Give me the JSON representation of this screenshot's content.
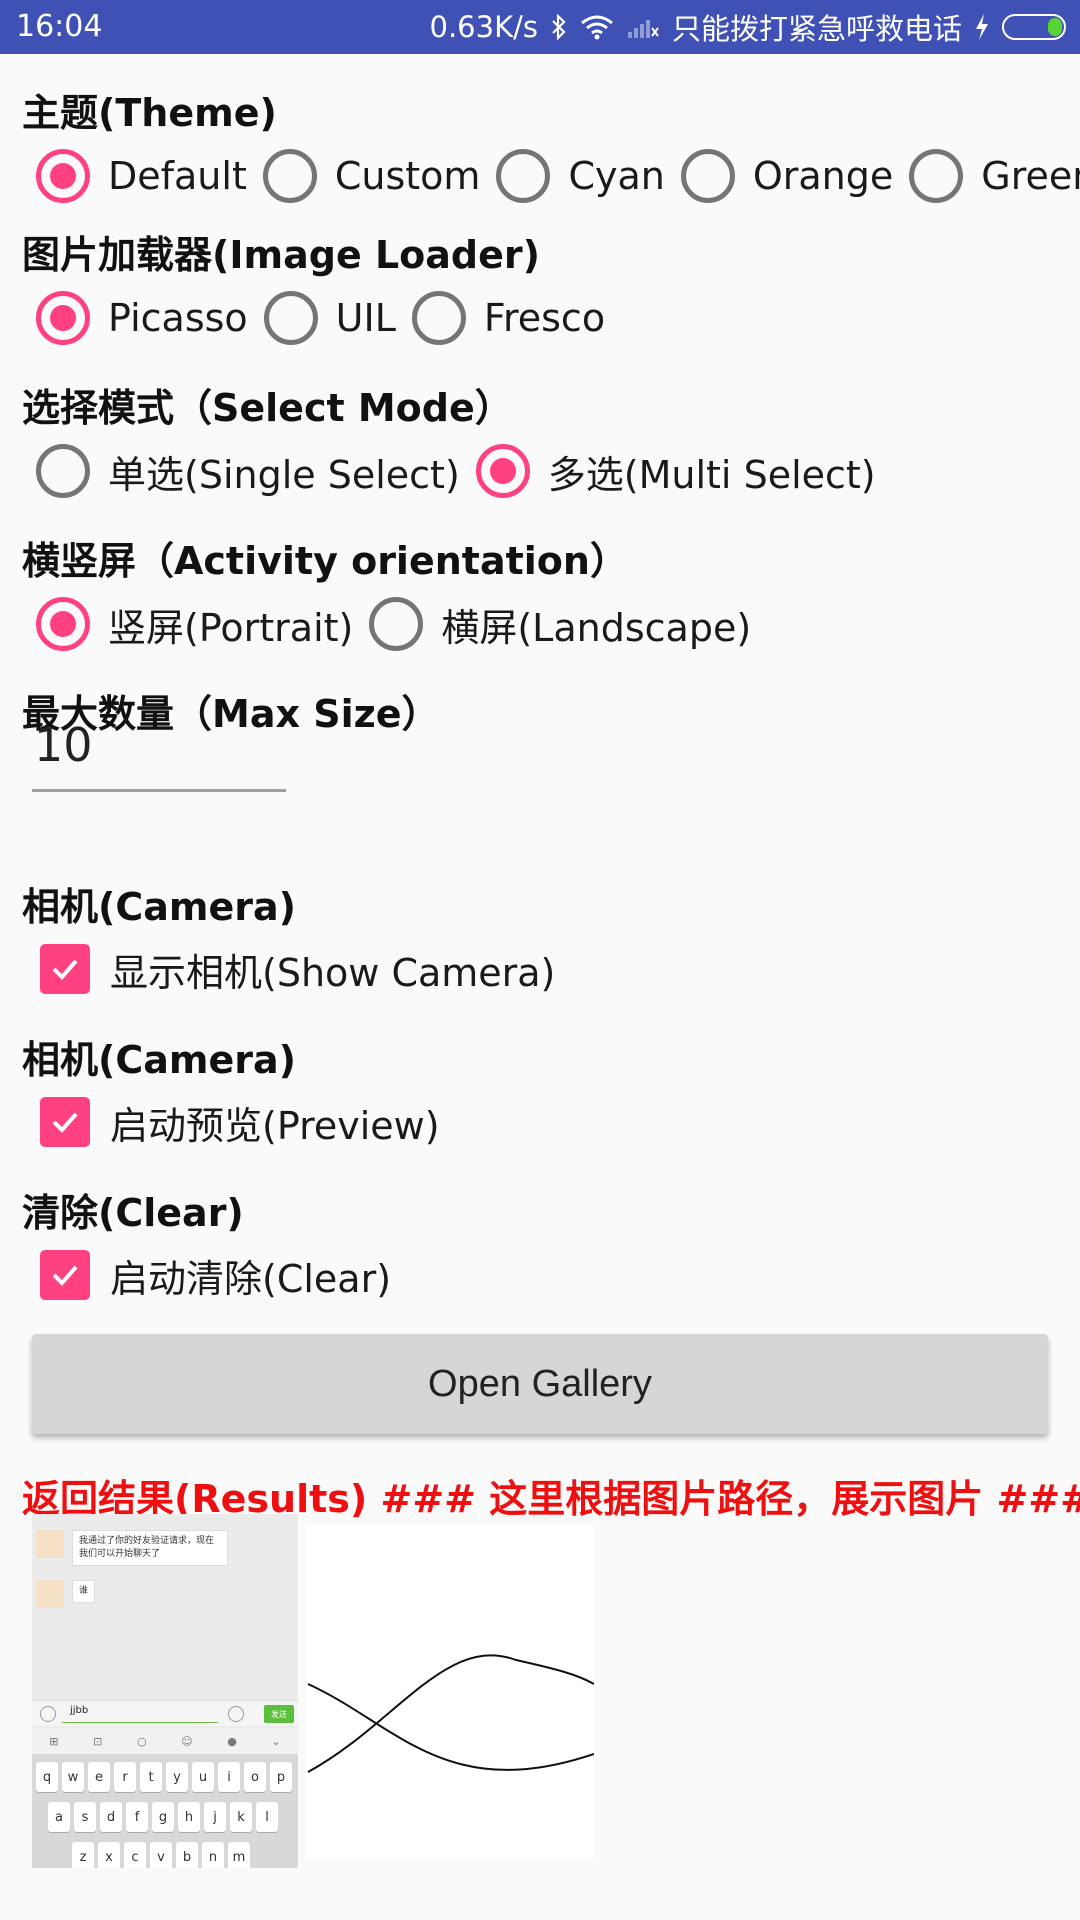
{
  "status_bar": {
    "time": "16:04",
    "speed": "0.63K/s",
    "carrier": "只能拨打紧急呼救电话",
    "icons": [
      "bluetooth-icon",
      "wifi-icon",
      "signal-icon",
      "charging-icon",
      "battery-icon"
    ]
  },
  "theme": {
    "heading": "主题(Theme)",
    "options": [
      "Default",
      "Custom",
      "Cyan",
      "Orange",
      "Green"
    ],
    "selected": "Default"
  },
  "image_loader": {
    "heading": "图片加载器(Image Loader)",
    "options": [
      "Picasso",
      "UIL",
      "Fresco"
    ],
    "selected": "Picasso"
  },
  "select_mode": {
    "heading": "选择模式（Select Mode）",
    "options": [
      "单选(Single Select)",
      "多选(Multi Select)"
    ],
    "selected": "多选(Multi Select)"
  },
  "orientation": {
    "heading": "横竖屏（Activity orientation）",
    "options": [
      "竖屏(Portrait)",
      "横屏(Landscape)"
    ],
    "selected": "竖屏(Portrait)"
  },
  "max_size": {
    "heading": "最大数量（Max Size）",
    "value": "10"
  },
  "camera": {
    "heading": "相机(Camera)",
    "checkbox_label": "显示相机(Show Camera)",
    "checked": true
  },
  "preview": {
    "heading": "相机(Camera)",
    "checkbox_label": "启动预览(Preview)",
    "checked": true
  },
  "clear": {
    "heading": "清除(Clear)",
    "checkbox_label": "启动清除(Clear)",
    "checked": true
  },
  "open_gallery_label": "Open Gallery",
  "results_label": "返回结果(Results) ### 这里根据图片路径，展示图片 ###",
  "thumbnails": {
    "chat_screenshot": {
      "message_1": "我通过了你的好友验证请求，现在我们可以开始聊天了",
      "message_2": "谁",
      "input_text": "jjbb",
      "send_label": "发送",
      "keyboard_rows": [
        [
          "q",
          "w",
          "e",
          "r",
          "t",
          "y",
          "u",
          "i",
          "o",
          "p"
        ],
        [
          "a",
          "s",
          "d",
          "f",
          "g",
          "h",
          "j",
          "k",
          "l"
        ],
        [
          "z",
          "x",
          "c",
          "v",
          "b",
          "n",
          "m"
        ]
      ]
    },
    "drawing": {}
  },
  "colors": {
    "status_bar": "#3f51b5",
    "accent": "#ff4081",
    "results_text": "#ee1010",
    "background": "#fafafa"
  }
}
